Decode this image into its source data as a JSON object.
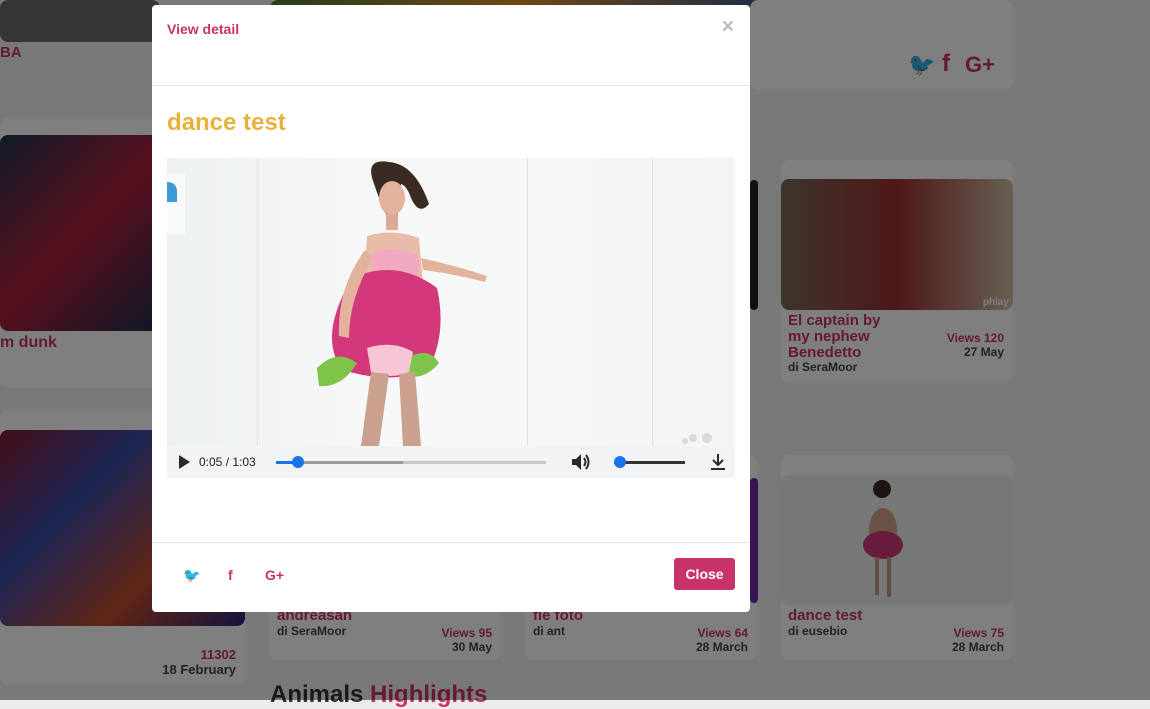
{
  "background": {
    "top_left_title": "BA",
    "left_mid_title": "m dunk",
    "cards": [
      {
        "title": "El captain by my nephew Benedetto",
        "author": "di SeraMoor",
        "views": "Views 120",
        "date": "27 May"
      },
      {
        "title": "andreasan",
        "author": "di SeraMoor",
        "views": "Views 95",
        "date": "30 May"
      },
      {
        "title": "fle foto",
        "author": "di ant",
        "views": "Views 64",
        "date": "28 March"
      },
      {
        "title": "dance test",
        "author": "di eusebio",
        "views": "Views 75",
        "date": "28 March"
      }
    ],
    "left_bottom": {
      "id": "11302",
      "date": "18 February"
    },
    "section_heading": {
      "part1": "Animals",
      "part2": "Highlights"
    },
    "watermark": "phlay"
  },
  "modal": {
    "title": "View detail",
    "close_symbol": "×",
    "video_title": "dance test",
    "player": {
      "time": "0:05 / 1:03",
      "progress": 0.08,
      "buffered": 0.47,
      "volume": 0.08
    },
    "share": [
      "twitter-icon",
      "facebook-icon",
      "google-plus-icon"
    ],
    "share_glyphs": [
      "🐦",
      "f",
      "G+"
    ],
    "close_label": "Close"
  },
  "colors": {
    "accent": "#c8336b",
    "title_gold": "#e8b23a"
  }
}
